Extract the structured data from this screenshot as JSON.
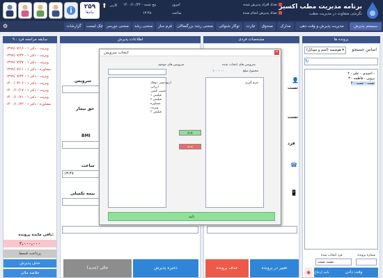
{
  "header": {
    "app_title": "برنامه مدیریت مطب اکسیر",
    "app_subtitle": "نگرشی متفاوت در مدیریت مطب",
    "stat_reg_label": "تعداد افراد پذیرش شده",
    "stat_done_label": "تعداد پذیرش انجام شده",
    "today_label": "امروز",
    "date_value": "۱۴۰۰/۱۰/۲۲ - پنج شنبه",
    "time_label": "ساعت",
    "time_value": "۱۳:۴۸",
    "user_label": "کاربر",
    "queue_count": "۲۵۹",
    "queue_label": "پیام‌ها"
  },
  "menu": {
    "items": [
      "سیستم پذیرش",
      "مدیریت پذیرش و وقت دهی",
      "مدارک",
      "صندوق",
      "چارت",
      "توکار شنوائی",
      "منحنی رشد بزرگسالان",
      "فرم ساز",
      "منحنی رشد",
      "منحنی دورسر",
      "چک لیست",
      "گزارشات"
    ]
  },
  "patients": {
    "header": "پرونده ها",
    "search_label": "اساس جستجو",
    "search_select": "هوشمند (اسم و موبایل)",
    "tree": [
      "۲ - احمدی - علی -",
      "۳ - پروین - فاطمه",
      "۴ - تست - تست"
    ],
    "footer_file_label": "شماره پرونده",
    "footer_name_label": "فرد انتخاب شده",
    "footer_name_value": "تست تست",
    "btn_appointment": "وقت دادن",
    "btn_letter": "نامه ارجاع"
  },
  "personal": {
    "header": "مشخصات فردی",
    "field_last": "تست",
    "field_first": "تست",
    "gender_label": "فرد",
    "btn_change": "تغییر در پرونده",
    "btn_delete": "حذف پرونده"
  },
  "admission": {
    "header": "اطلاعات پذیرش",
    "service_label": "سرویس",
    "doctor_share_label": "حق بیمار",
    "bmi_label": "BMI",
    "time_label": "ساعت",
    "time_value": "۱۳:۴۷",
    "insurance_label": "بیمه تکمیلی",
    "btn_save": "ذخیره پذیرش",
    "btn_clear": "خالی (جدید)"
  },
  "history": {
    "header": "سابقه مراجعه فرد : ۹",
    "items": [
      "۱۳۹۹/۰۷/۱۶ - ویزیت - دکتر ۱",
      "۱۳۹۹/۰۷/۲۴ - ویزیت - دکتر ۱",
      "۱۳۹۹/۰۷/۲۷ - ویزیت - دکتر ۱",
      "۱۳۹۹/۰۷/۱۱ - مشاوره - دکتر ۱",
      "۱۳۹۹/۰۷/۲۴ - ویزیت - دکتر ۱",
      "۱۴۰۰/۰۳/۰۶ - ویزیت - دکتر ۱",
      "۱۴۰۰/۱۰/۱۷ - ویزیت - دکتر ۱",
      "۱۴۰۰/۱۰/۲۱ - ویزیت - دکتر ۱",
      "۱۴۰۰/۱۰/۲۲ - مشاوره - دکتر ۱"
    ],
    "balance_label": "باقی مانده پرونده:",
    "balance_value": "۳,۰۰۰,۰۰۰",
    "btn_receive": "پرداخت قسط",
    "btn_delete": "حذف پذیرش",
    "btn_summary": "خلاصه مالی"
  },
  "modal": {
    "title": "انتخاب سرویس",
    "available_title": "سرویس های موجود",
    "selected_title": "سرویس های انتخاب شده",
    "total_label": "مجموع مبلغ",
    "total_value": "۱۰۰۰۰۰۰",
    "available": [
      "ارتودنسی دوفک",
      "ارزانی",
      "عصب کشی",
      "فیلنس ۱",
      "فیلنس ۲",
      "مشاوره",
      "ویزیت",
      "فیلنس ۳"
    ],
    "selected": [
      "جرم گیری"
    ],
    "add_label": ">>",
    "remove_label": "<<",
    "ok_label": "تایید"
  }
}
